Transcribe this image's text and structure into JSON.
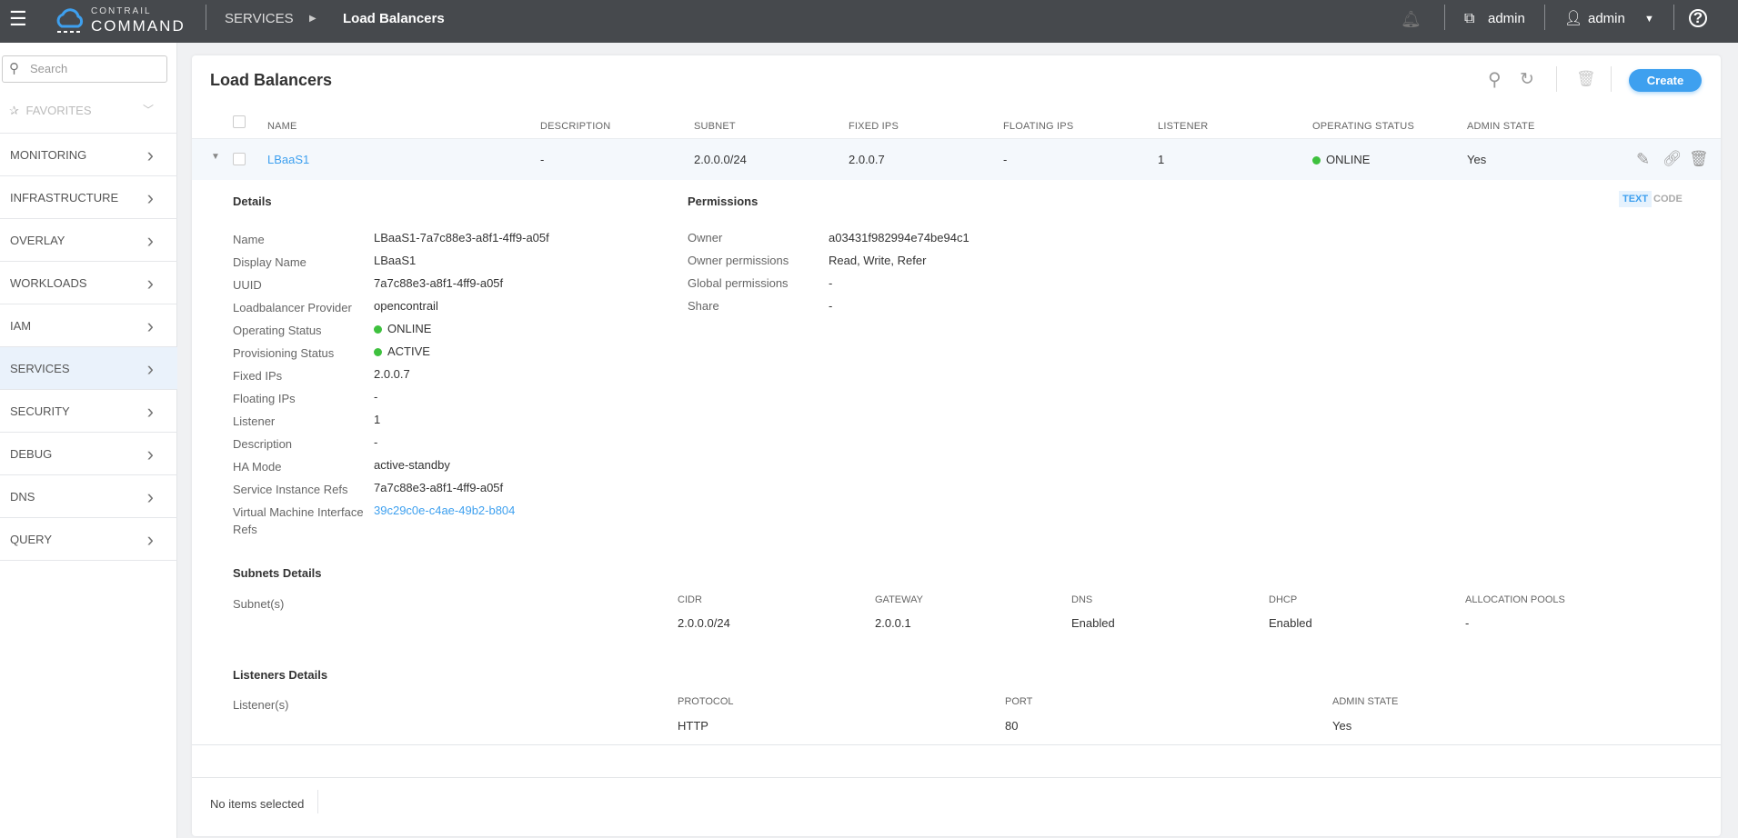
{
  "header": {
    "logo_top": "CONTRAIL",
    "logo_bottom": "COMMAND",
    "breadcrumb": [
      "SERVICES",
      "Load Balancers"
    ],
    "project": "admin",
    "user": "admin"
  },
  "sidebar": {
    "search_placeholder": "Search",
    "favorites": "FAVORITES",
    "items": [
      {
        "label": "MONITORING"
      },
      {
        "label": "INFRASTRUCTURE"
      },
      {
        "label": "OVERLAY"
      },
      {
        "label": "WORKLOADS"
      },
      {
        "label": "IAM"
      },
      {
        "label": "SERVICES",
        "active": true
      },
      {
        "label": "SECURITY"
      },
      {
        "label": "DEBUG"
      },
      {
        "label": "DNS"
      },
      {
        "label": "QUERY"
      }
    ]
  },
  "main": {
    "title": "Load Balancers",
    "create_label": "Create",
    "columns": [
      "NAME",
      "DESCRIPTION",
      "SUBNET",
      "FIXED IPS",
      "FLOATING IPS",
      "LISTENER",
      "OPERATING STATUS",
      "ADMIN STATE"
    ],
    "row": {
      "name": "LBaaS1",
      "description": "-",
      "subnet": "2.0.0.0/24",
      "fixed_ips": "2.0.0.7",
      "floating_ips": "-",
      "listener": "1",
      "operating_status": "ONLINE",
      "admin_state": "Yes"
    },
    "details": {
      "title": "Details",
      "fields": [
        {
          "label": "Name",
          "value": "LBaaS1-7a7c88e3-a8f1-4ff9-a05f"
        },
        {
          "label": "Display Name",
          "value": "LBaaS1"
        },
        {
          "label": "UUID",
          "value": "7a7c88e3-a8f1-4ff9-a05f"
        },
        {
          "label": "Loadbalancer Provider",
          "value": "opencontrail"
        },
        {
          "label": "Operating Status",
          "value": "ONLINE"
        },
        {
          "label": "Provisioning Status",
          "value": "ACTIVE"
        },
        {
          "label": "Fixed IPs",
          "value": "2.0.0.7"
        },
        {
          "label": "Floating IPs",
          "value": "-"
        },
        {
          "label": "Listener",
          "value": "1"
        },
        {
          "label": "Description",
          "value": "-"
        },
        {
          "label": "HA Mode",
          "value": "active-standby"
        },
        {
          "label": "Service Instance Refs",
          "value": "7a7c88e3-a8f1-4ff9-a05f"
        },
        {
          "label": "Virtual Machine Interface Refs",
          "value": "39c29c0e-c4ae-49b2-b804"
        }
      ]
    },
    "permissions": {
      "title": "Permissions",
      "fields": [
        {
          "label": "Owner",
          "value": "a03431f982994e74be94c1"
        },
        {
          "label": "Owner permissions",
          "value": "Read, Write, Refer"
        },
        {
          "label": "Global permissions",
          "value": "-"
        },
        {
          "label": "Share",
          "value": "-"
        }
      ]
    },
    "view_toggle": {
      "text": "TEXT",
      "code": "CODE"
    },
    "subnets": {
      "title": "Subnets Details",
      "label": "Subnet(s)",
      "columns": [
        "CIDR",
        "GATEWAY",
        "DNS",
        "DHCP",
        "ALLOCATION POOLS"
      ],
      "values": [
        "2.0.0.0/24",
        "2.0.0.1",
        "Enabled",
        "Enabled",
        "-"
      ]
    },
    "listeners": {
      "title": "Listeners Details",
      "label": "Listener(s)",
      "columns": [
        "PROTOCOL",
        "PORT",
        "ADMIN STATE"
      ],
      "values": [
        "HTTP",
        "80",
        "Yes"
      ]
    },
    "footer": {
      "status": "No items selected"
    }
  },
  "colors": {
    "accent": "#3ea0ef",
    "online": "#3ec13e",
    "header_bg": "#46494d"
  }
}
